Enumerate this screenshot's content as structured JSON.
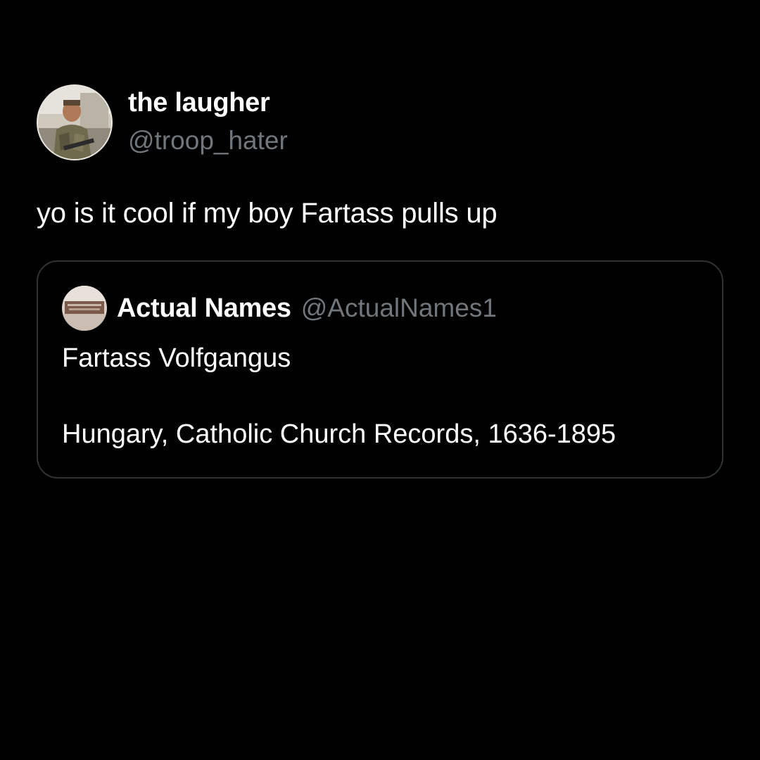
{
  "tweet": {
    "author": {
      "display_name": "the laugher",
      "handle": "@troop_hater",
      "avatar_icon": "profile-photo-avatar"
    },
    "text": "yo is it cool if my boy Fartass pulls up"
  },
  "quote": {
    "author": {
      "display_name": "Actual Names",
      "handle": "@ActualNames1",
      "avatar_icon": "document-record-avatar"
    },
    "lines": [
      "Fartass Volfgangus",
      "Hungary, Catholic Church Records, 1636-1895"
    ]
  },
  "colors": {
    "background": "#000000",
    "primary_text": "#ffffff",
    "secondary_text": "#71767b",
    "border": "#2f3336"
  }
}
